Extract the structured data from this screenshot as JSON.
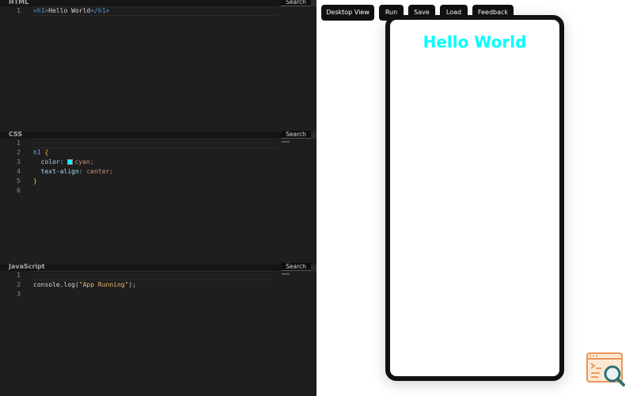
{
  "editors": {
    "html": {
      "title": "HTML",
      "search_label": "Search",
      "line_numbers": [
        "1"
      ],
      "lines": [
        [
          "<h1>",
          "Hello World",
          "</h1>"
        ]
      ]
    },
    "css": {
      "title": "CSS",
      "search_label": "Search",
      "line_numbers": [
        "1",
        "2",
        "3",
        "4",
        "5",
        "6"
      ],
      "selector": "h1",
      "open_brace": "{",
      "close_brace": "}",
      "prop1": "color:",
      "val1": "cyan;",
      "prop2": "text-align:",
      "val2": "center;"
    },
    "js": {
      "title": "JavaScript",
      "search_label": "Search",
      "line_numbers": [
        "1",
        "2",
        "3"
      ],
      "call": "console.log(",
      "string": "\"App Running\"",
      "end": ");"
    }
  },
  "toolbar": {
    "desktop_view": "Desktop View",
    "run": "Run",
    "save": "Save",
    "load": "Load",
    "feedback": "Feedback"
  },
  "preview": {
    "heading": "Hello World",
    "heading_color": "#00ffff"
  },
  "colors": {
    "editor_bg": "#1e1e1e",
    "button_bg": "#111111"
  }
}
